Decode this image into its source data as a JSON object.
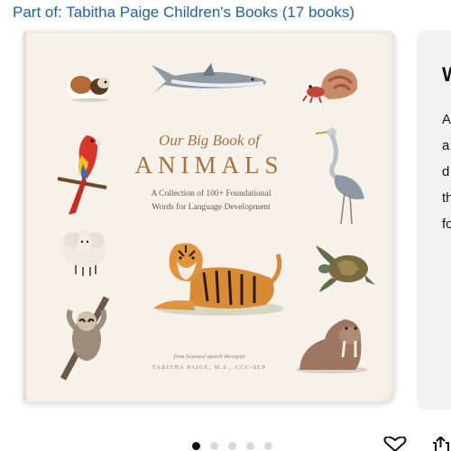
{
  "series": {
    "label": "Part of: Tabitha Paige Children's Books (17 books)"
  },
  "cover": {
    "title_line1": "Our Big Book of",
    "title_line2": "ANIMALS",
    "subtitle_line1": "A Collection of 100+ Foundational",
    "subtitle_line2": "Words for Language Development",
    "credit": "from licensed speech therapist",
    "author": "TABITHA PAIGE, M.S., CCC-SLP",
    "animals": [
      "guinea-pig",
      "shark",
      "hermit-crab",
      "parrot",
      "heron",
      "sheep",
      "tiger",
      "sea-turtle",
      "sloth",
      "walrus"
    ]
  },
  "side_panel": {
    "heading": "W",
    "text_lines": [
      "A",
      "a",
      "d",
      "th",
      "fo"
    ]
  },
  "carousel": {
    "dot_count": 5,
    "active_index": 0
  },
  "actions": {
    "favorite_icon": "heart-icon",
    "share_icon": "share-icon"
  },
  "colors": {
    "link": "#2162a1",
    "title": "#a5713f",
    "cover_background": "#f6f2ea"
  }
}
